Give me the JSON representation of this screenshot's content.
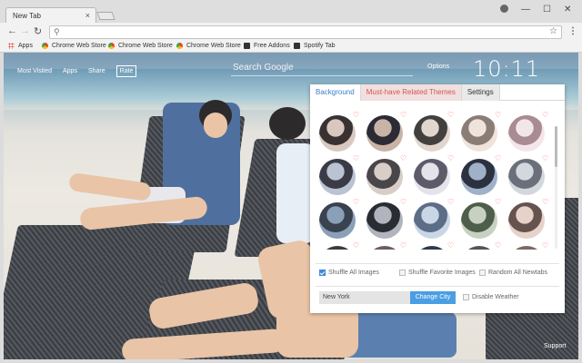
{
  "browser": {
    "tab_title": "New Tab",
    "tab_close": "×",
    "window_controls": {
      "minimize": "—",
      "maximize": "☐",
      "close": "✕"
    }
  },
  "bookmarks": [
    {
      "label": "Apps",
      "icon": "apps-grid-icon"
    },
    {
      "label": "Chrome Web Store",
      "icon": "chrome-web-store-icon"
    },
    {
      "label": "Chrome Web Store",
      "icon": "chrome-web-store-icon"
    },
    {
      "label": "Chrome Web Store",
      "icon": "chrome-web-store-icon"
    },
    {
      "label": "Free Addons",
      "icon": "addon-icon"
    },
    {
      "label": "Spotify Tab",
      "icon": "addon-icon"
    }
  ],
  "newtab": {
    "nav": [
      "Most Visited",
      "Apps",
      "Share",
      "Rate"
    ],
    "search_placeholder": "Search Google",
    "options_label": "Options",
    "clock": "10:11",
    "support_label": "Support"
  },
  "panel": {
    "tabs": [
      "Background",
      "Must-have Related Themes",
      "Settings"
    ],
    "active_tab": "Background",
    "thumb_count": 25,
    "options": {
      "shuffle_all": {
        "label": "Shuffle All Images",
        "checked": true
      },
      "shuffle_fav": {
        "label": "Shuffle Favorite Images",
        "checked": false
      },
      "random_all": {
        "label": "Random All Newtabs",
        "checked": false
      }
    },
    "city_value": "New York",
    "change_city_label": "Change City",
    "disable_weather": {
      "label": "Disable Weather",
      "checked": false
    }
  },
  "colors": {
    "accent": "#3d7ec9",
    "related_tab_text": "#d9534f",
    "heart": "#ff6a5c",
    "button": "#4a9ee3"
  }
}
